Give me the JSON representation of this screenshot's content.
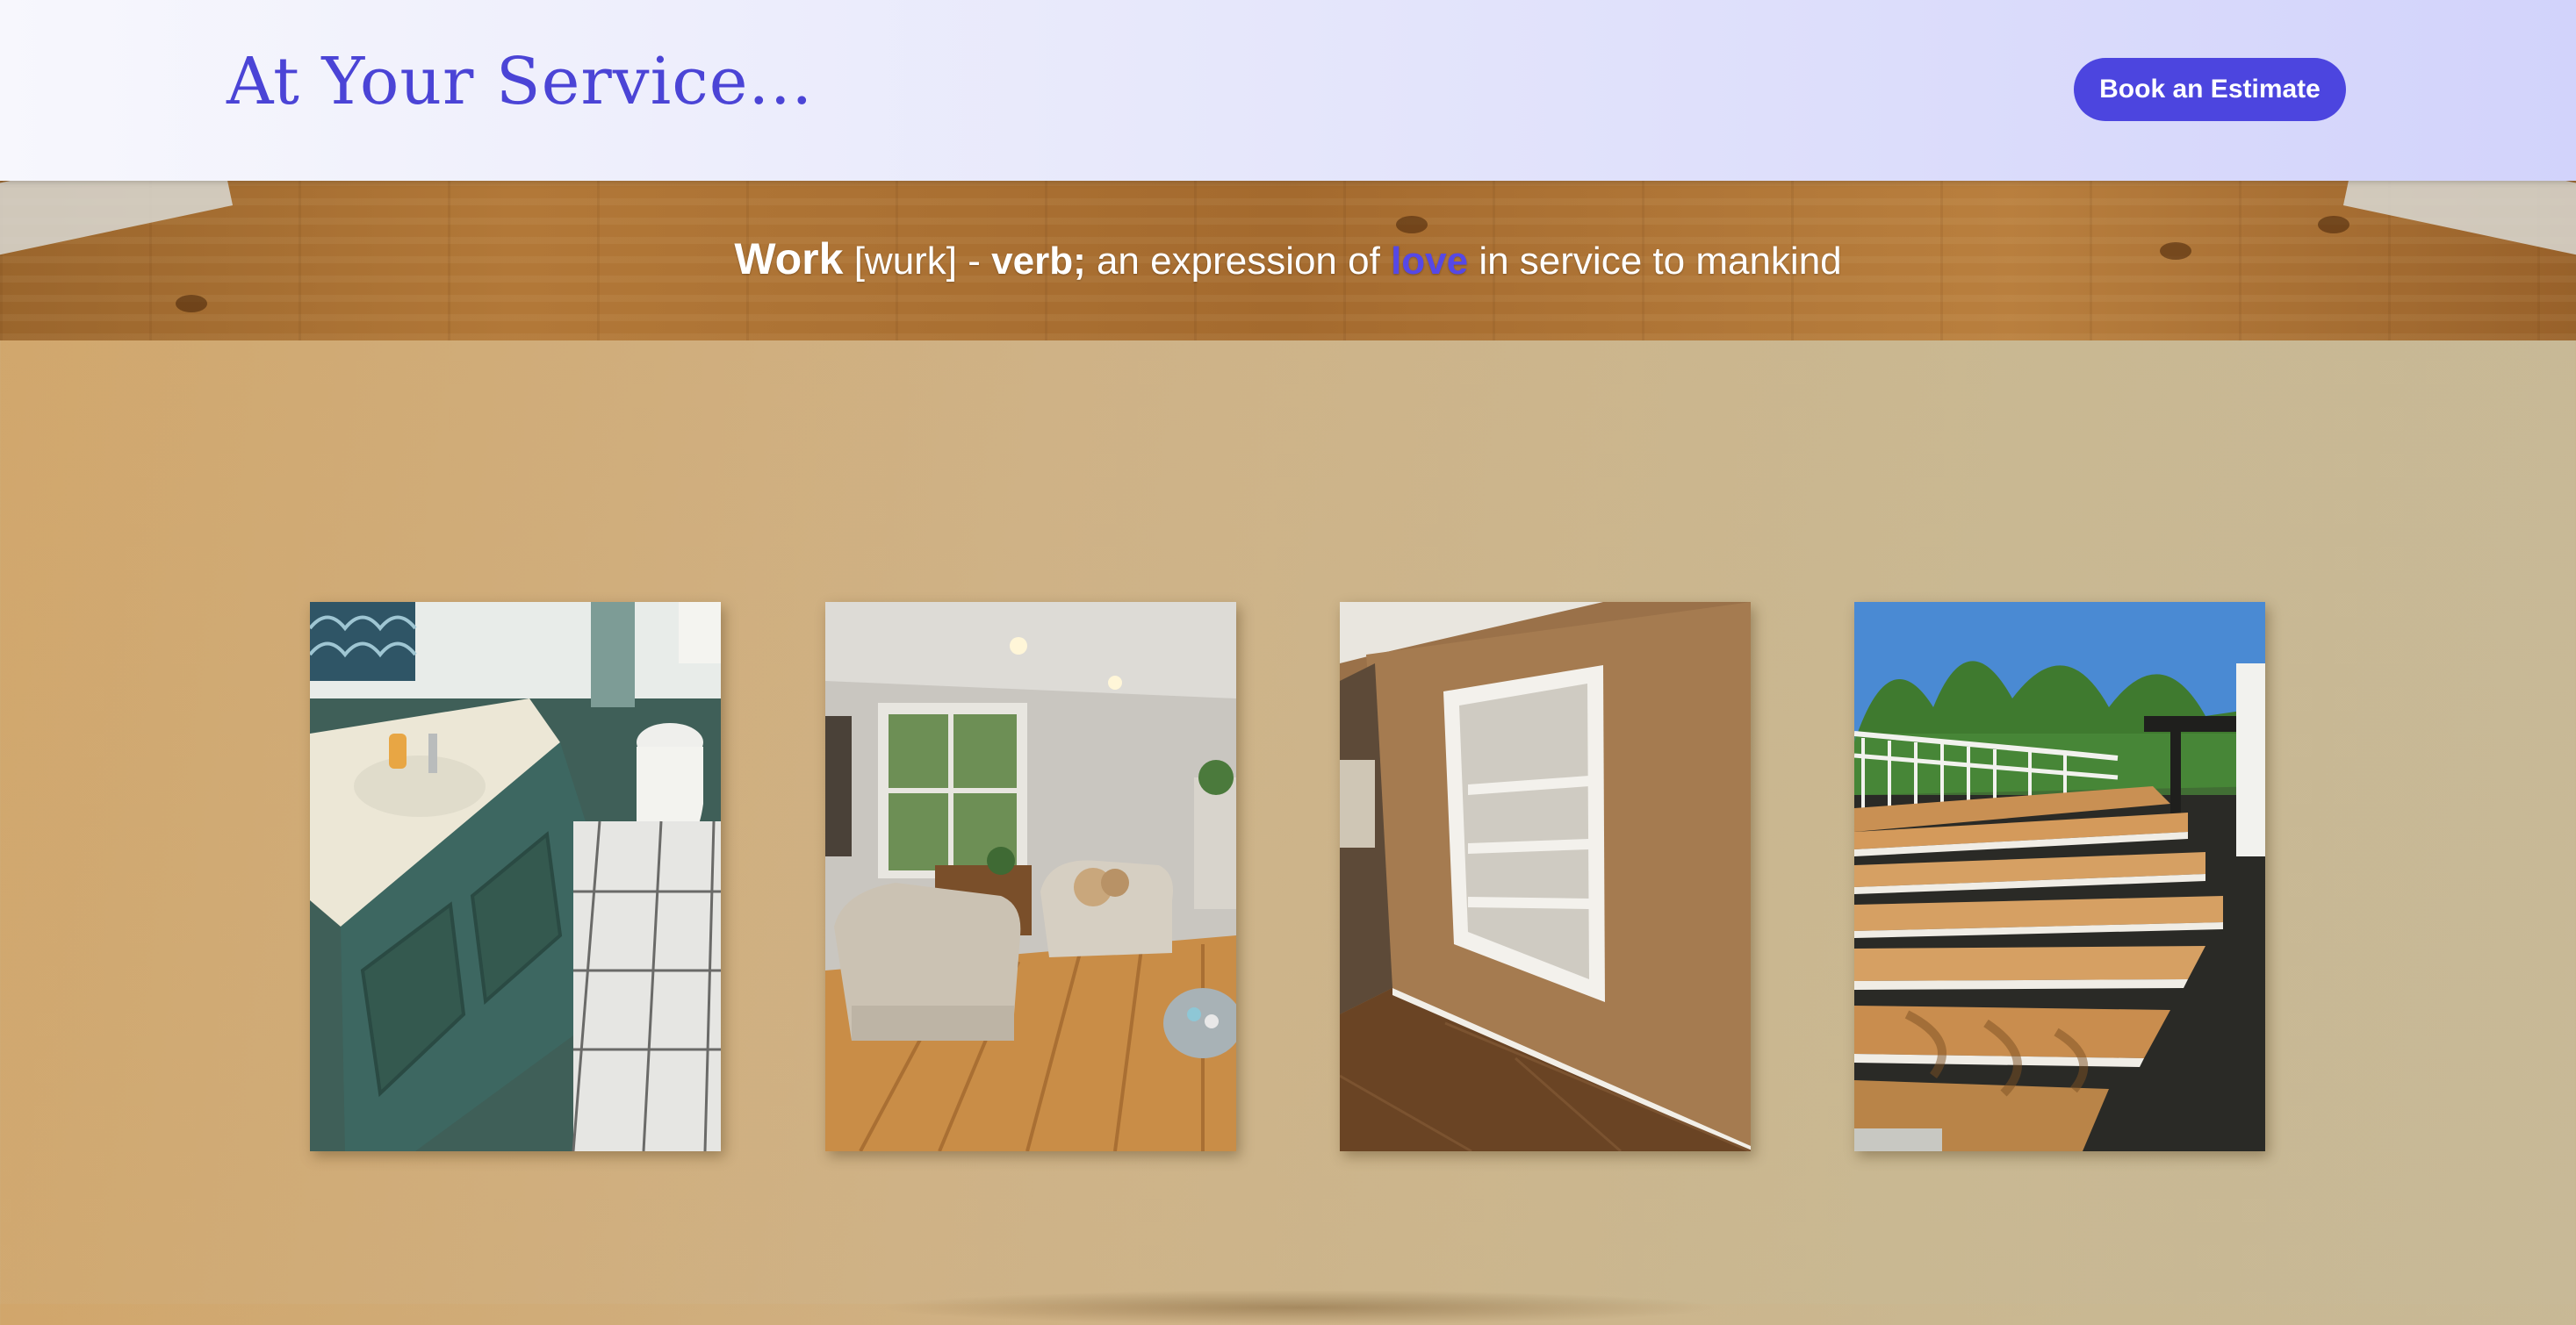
{
  "header": {
    "logo_text": "At Your Service...",
    "cta_label": "Book an Estimate"
  },
  "banner": {
    "word": "Work",
    "pronunciation": "[wurk] - ",
    "part_of_speech": "verb;",
    "definition_before": " an expression of ",
    "highlight": "love",
    "definition_after": " in service to mankind"
  },
  "colors": {
    "brand": "#4c45df",
    "logo": "#4b44d6",
    "highlight": "#5648e6"
  },
  "gallery": {
    "photos": [
      {
        "subject": "bathroom vanity renovation"
      },
      {
        "subject": "living room with hardwood floor"
      },
      {
        "subject": "built-in recessed wall shelf"
      },
      {
        "subject": "deck stairs"
      }
    ]
  }
}
